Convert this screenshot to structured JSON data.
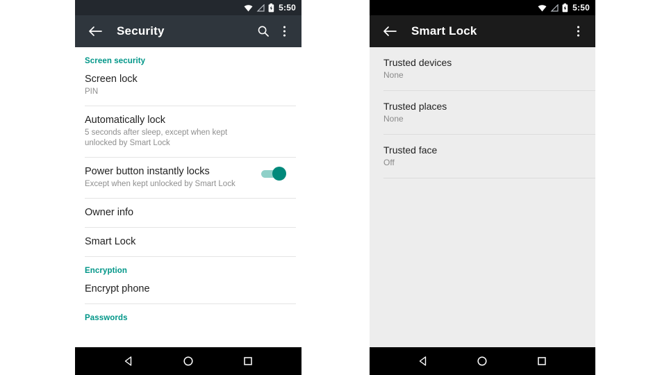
{
  "left_phone": {
    "status_bar": {
      "clock": "5:50",
      "icons": [
        "wifi-icon",
        "signal-icon",
        "battery-icon"
      ]
    },
    "app_bar": {
      "back_icon": "back-arrow-icon",
      "title": "Security",
      "search_icon": "search-icon",
      "overflow_icon": "overflow-menu-icon"
    },
    "sections": [
      {
        "header": "Screen security",
        "rows": [
          {
            "title": "Screen lock",
            "subtitle": "PIN",
            "toggle": null
          },
          {
            "title": "Automatically lock",
            "subtitle": "5 seconds after sleep, except when kept unlocked by Smart Lock",
            "toggle": null
          },
          {
            "title": "Power button instantly locks",
            "subtitle": "Except when kept unlocked by Smart Lock",
            "toggle": "on"
          },
          {
            "title": "Owner info",
            "subtitle": "",
            "toggle": null
          },
          {
            "title": "Smart Lock",
            "subtitle": "",
            "toggle": null
          }
        ]
      },
      {
        "header": "Encryption",
        "rows": [
          {
            "title": "Encrypt phone",
            "subtitle": "",
            "toggle": null
          }
        ]
      },
      {
        "header": "Passwords",
        "rows": []
      }
    ],
    "nav_bar": {
      "back": "nav-back-icon",
      "home": "nav-home-icon",
      "recents": "nav-recents-icon"
    }
  },
  "right_phone": {
    "status_bar": {
      "clock": "5:50",
      "icons": [
        "wifi-icon",
        "signal-icon",
        "battery-icon"
      ]
    },
    "app_bar": {
      "back_icon": "back-arrow-icon",
      "title": "Smart Lock",
      "overflow_icon": "overflow-menu-icon"
    },
    "rows": [
      {
        "title": "Trusted devices",
        "subtitle": "None"
      },
      {
        "title": "Trusted places",
        "subtitle": "None"
      },
      {
        "title": "Trusted face",
        "subtitle": "Off"
      }
    ],
    "nav_bar": {
      "back": "nav-back-icon",
      "home": "nav-home-icon",
      "recents": "nav-recents-icon"
    }
  },
  "colors": {
    "accent_teal": "#009688",
    "left_appbar": "#2f363d",
    "right_appbar": "#1b1b1b",
    "left_statusbar": "#23282e",
    "right_statusbar": "#000000",
    "right_background": "#ededed",
    "nav_bar": "#000000",
    "primary_text": "#212121",
    "secondary_text": "#8e8e8e"
  }
}
